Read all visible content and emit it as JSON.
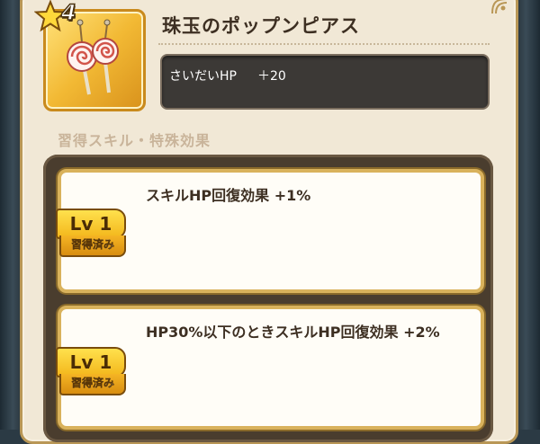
{
  "item": {
    "rarity": "4",
    "name": "珠玉のポップンピアス",
    "icon": "lollipop-earrings-icon"
  },
  "stat": {
    "label": "さいだいHP",
    "value": "＋20"
  },
  "section_title": "習得スキル・特殊効果",
  "skills": [
    {
      "level": "Lv 1",
      "status": "習得済み",
      "text": "スキルHP回復効果 +1%"
    },
    {
      "level": "Lv 1",
      "status": "習得済み",
      "text": "HP30%以下のときスキルHP回復効果 +2%"
    }
  ],
  "colors": {
    "panel": "#f1e8d6",
    "gold": "#f3b71c",
    "stat_box": "#3c3936",
    "frame": "#4a3d2e"
  }
}
